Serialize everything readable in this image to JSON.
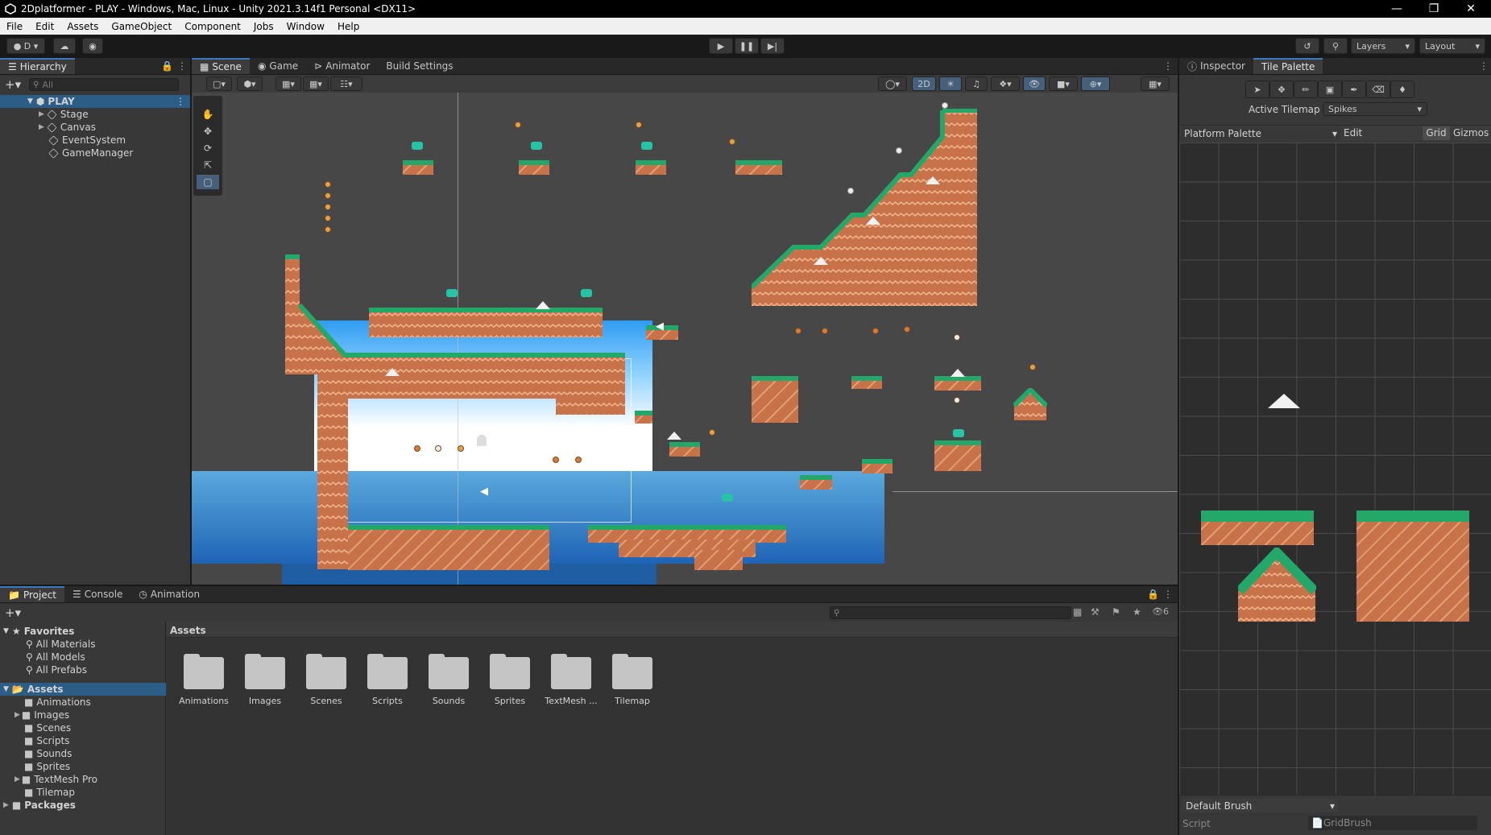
{
  "window": {
    "title": "2Dplatformer - PLAY - Windows, Mac, Linux - Unity 2021.3.14f1 Personal <DX11>"
  },
  "menu": [
    "File",
    "Edit",
    "Assets",
    "GameObject",
    "Component",
    "Jobs",
    "Window",
    "Help"
  ],
  "toolbar": {
    "account_label": "D",
    "layers_label": "Layers",
    "layout_label": "Layout"
  },
  "hierarchy": {
    "tab": "Hierarchy",
    "search_placeholder": "All",
    "scene_name": "PLAY",
    "items": [
      "Stage",
      "Canvas",
      "EventSystem",
      "GameManager"
    ]
  },
  "scene_tabs": [
    "Scene",
    "Game",
    "Animator",
    "Build Settings"
  ],
  "scene_toolbar": {
    "mode_2d": "2D"
  },
  "inspector": {
    "tabs": [
      "Inspector",
      "Tile Palette"
    ],
    "active_tilemap_label": "Active Tilemap",
    "active_tilemap_value": "Spikes",
    "palette_name": "Platform Palette",
    "edit_label": "Edit",
    "grid_label": "Grid",
    "gizmos_label": "Gizmos",
    "brush_label": "Default Brush",
    "script_label": "Script",
    "script_value": "GridBrush"
  },
  "bottom": {
    "tabs": [
      "Project",
      "Console",
      "Animation"
    ],
    "hidden_count": "6",
    "favorites_label": "Favorites",
    "favorites": [
      "All Materials",
      "All Models",
      "All Prefabs"
    ],
    "assets_label": "Assets",
    "asset_tree": [
      "Animations",
      "Images",
      "Scenes",
      "Scripts",
      "Sounds",
      "Sprites",
      "TextMesh Pro",
      "Tilemap"
    ],
    "packages_label": "Packages",
    "breadcrumb": "Assets",
    "folders": [
      "Animations",
      "Images",
      "Scenes",
      "Scripts",
      "Sounds",
      "Sprites",
      "TextMesh ...",
      "Tilemap"
    ]
  },
  "colors": {
    "accent": "#3a79bb",
    "selection": "#2c5d87",
    "grass": "#24a86a",
    "dirt": "#c8724a",
    "water": "#2f74b8"
  }
}
